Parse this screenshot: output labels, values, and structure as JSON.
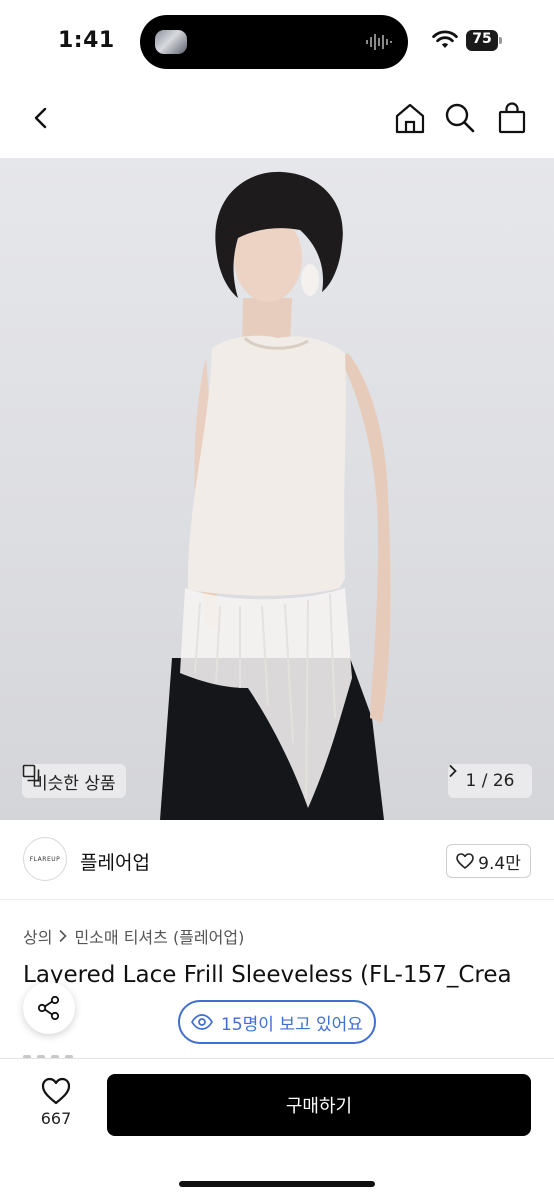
{
  "status_bar": {
    "time": "1:41",
    "battery": "75"
  },
  "nav": {
    "back": "back-icon",
    "home": "home-icon",
    "search": "search-icon",
    "cart": "shopping-bag-icon"
  },
  "image": {
    "similar_label": "비슷한 상품",
    "page_indicator": "1 / 26"
  },
  "brand": {
    "logo_text": "FLAREUP",
    "name": "플레어업",
    "likes": "9.4만"
  },
  "breadcrumb": [
    "상의",
    "민소매 티셔츠 (플레어업)"
  ],
  "product": {
    "title": "Layered Lace Frill Sleeveless (FL-157_Crea"
  },
  "viewers": "15명이 보고 있어요",
  "bottom": {
    "wish_count": "667",
    "buy_label": "구매하기"
  },
  "colors": {
    "accent_blue": "#3f6fd0",
    "buy_button": "#000000"
  }
}
